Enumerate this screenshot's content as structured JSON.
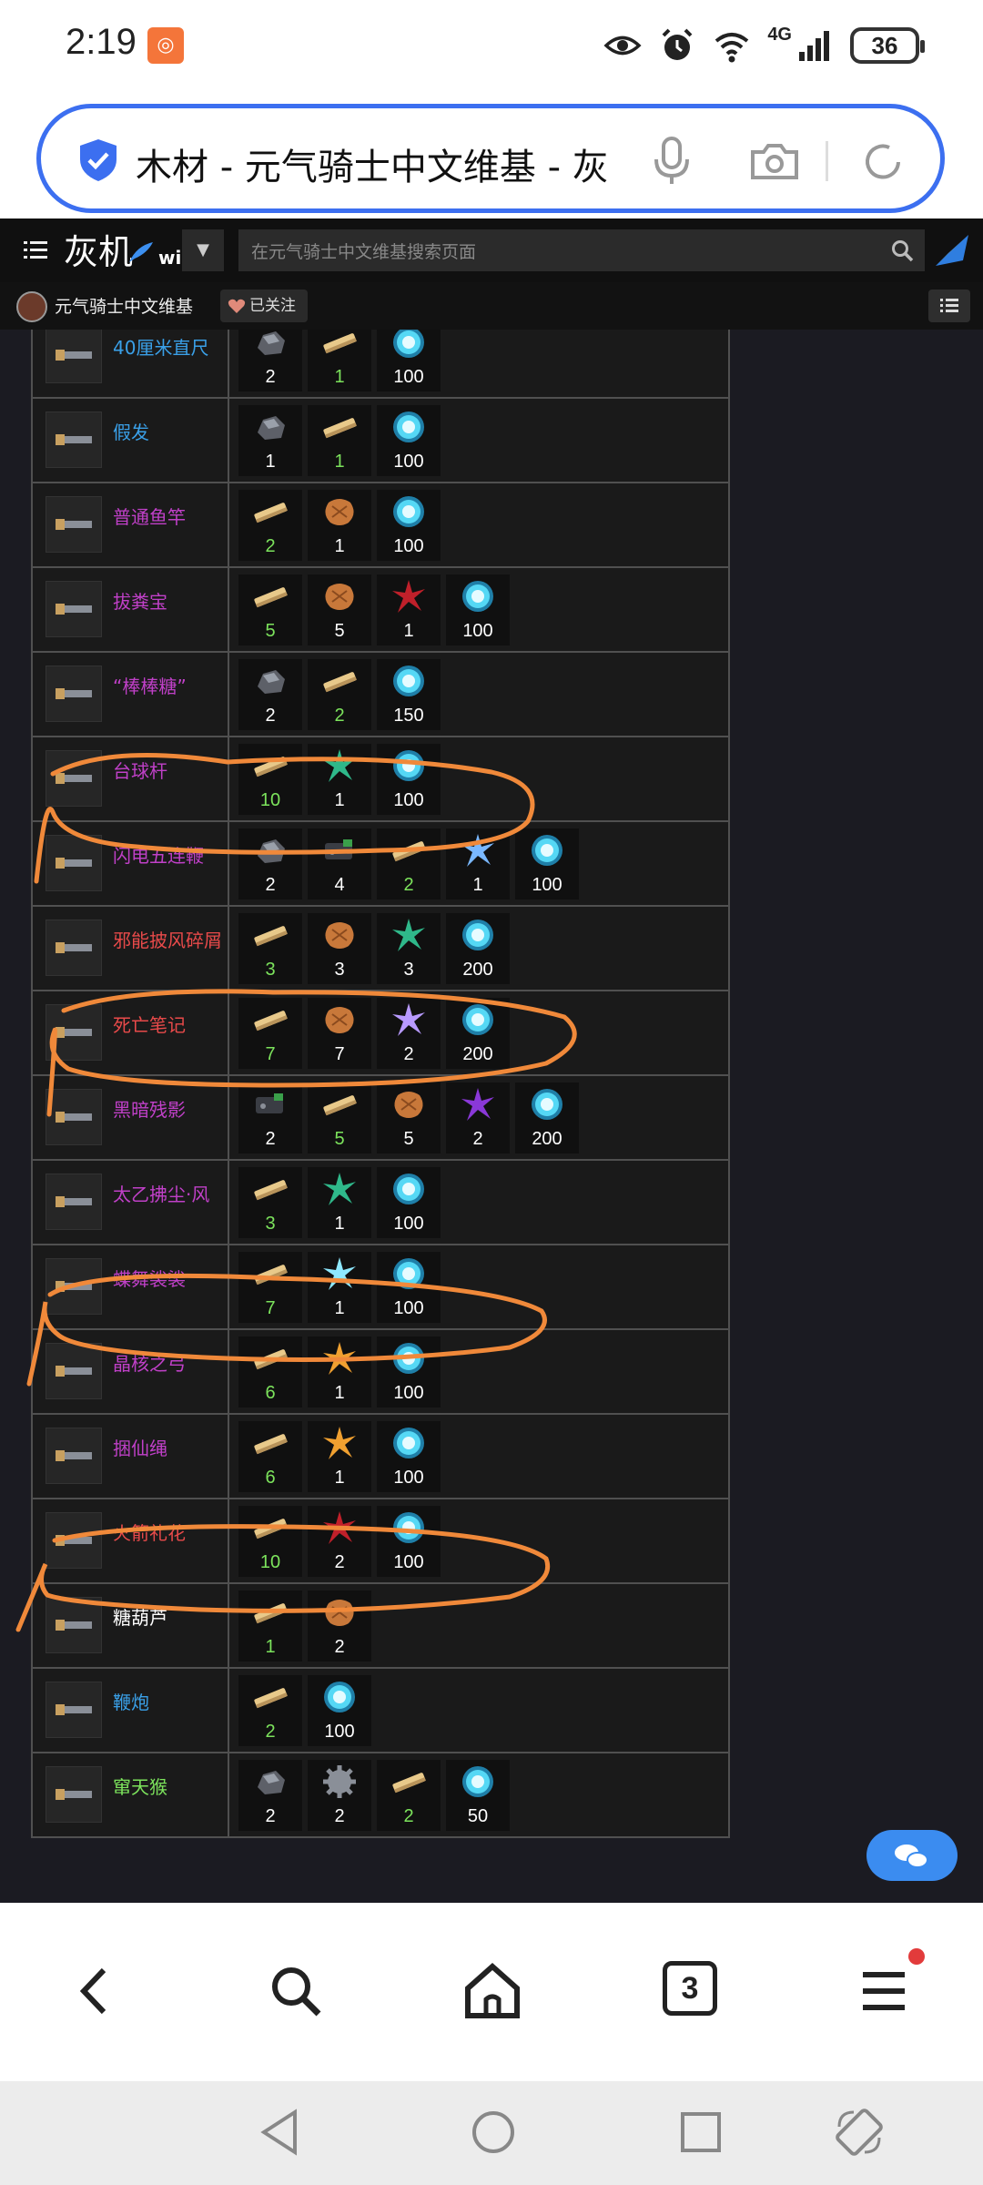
{
  "status_bar": {
    "time": "2:19",
    "network": "4G",
    "battery": "36",
    "app_icon": "weibo-style-app-icon"
  },
  "address_bar": {
    "title": "木材 - 元气骑士中文维基 - 灰"
  },
  "wiki_header": {
    "logo_text": "灰机",
    "logo_suffix": "wiki",
    "search_placeholder": "在元气骑士中文维基搜索页面",
    "site_name": "元气骑士中文维基",
    "follow_label": "已关注"
  },
  "materials_legend": {
    "ore": "#9aa0aa",
    "wood": "#e8c98a",
    "gem": "#55d8f5"
  },
  "crafting_rows": [
    {
      "name": "",
      "name_color": "#3aa0e8",
      "icon": "partial-row-icon",
      "materials": [
        {
          "type": "ore",
          "qty": "2"
        },
        {
          "type": "wood",
          "qty": "1"
        },
        {
          "type": "gem",
          "qty": "100"
        }
      ]
    },
    {
      "name": "40厘米直尺",
      "name_color": "#3aa0e8",
      "icon": "ruler-icon",
      "materials": [
        {
          "type": "ore",
          "qty": "2"
        },
        {
          "type": "wood",
          "qty": "1"
        },
        {
          "type": "gem",
          "qty": "100"
        }
      ]
    },
    {
      "name": "假发",
      "name_color": "#3aa0e8",
      "icon": "wig-icon",
      "materials": [
        {
          "type": "ore",
          "qty": "1"
        },
        {
          "type": "wood",
          "qty": "1"
        },
        {
          "type": "gem",
          "qty": "100"
        }
      ]
    },
    {
      "name": "普通鱼竿",
      "name_color": "#c040c8",
      "icon": "fishing-rod-icon",
      "materials": [
        {
          "type": "wood",
          "qty": "2"
        },
        {
          "type": "leather",
          "qty": "1"
        },
        {
          "type": "gem",
          "qty": "100"
        }
      ]
    },
    {
      "name": "拔粪宝",
      "name_color": "#c040c8",
      "icon": "plunger-icon",
      "materials": [
        {
          "type": "wood",
          "qty": "5"
        },
        {
          "type": "leather",
          "qty": "5"
        },
        {
          "type": "red-crystal",
          "qty": "1"
        },
        {
          "type": "gem",
          "qty": "100"
        }
      ]
    },
    {
      "name": "“棒棒糖”",
      "name_color": "#c040c8",
      "icon": "lollipop-icon",
      "materials": [
        {
          "type": "ore",
          "qty": "2"
        },
        {
          "type": "wood",
          "qty": "2"
        },
        {
          "type": "gem",
          "qty": "150"
        }
      ]
    },
    {
      "name": "台球杆",
      "name_color": "#c040c8",
      "icon": "cue-icon",
      "materials": [
        {
          "type": "wood",
          "qty": "10"
        },
        {
          "type": "green-crystal",
          "qty": "1"
        },
        {
          "type": "gem",
          "qty": "100"
        }
      ]
    },
    {
      "name": "闪电五连鞭",
      "name_color": "#c040c8",
      "icon": "whip-icon",
      "materials": [
        {
          "type": "ore",
          "qty": "2"
        },
        {
          "type": "circuit",
          "qty": "4"
        },
        {
          "type": "wood",
          "qty": "2"
        },
        {
          "type": "blue-crystal",
          "qty": "1"
        },
        {
          "type": "gem",
          "qty": "100"
        }
      ]
    },
    {
      "name": "邪能披风碎屑",
      "name_color": "#e84a4a",
      "icon": "cape-icon",
      "materials": [
        {
          "type": "wood",
          "qty": "3"
        },
        {
          "type": "leather",
          "qty": "3"
        },
        {
          "type": "green-crystal",
          "qty": "3"
        },
        {
          "type": "gem",
          "qty": "200"
        }
      ]
    },
    {
      "name": "死亡笔记",
      "name_color": "#e84a4a",
      "icon": "notebook-icon",
      "materials": [
        {
          "type": "wood",
          "qty": "7"
        },
        {
          "type": "leather",
          "qty": "7"
        },
        {
          "type": "purple-crystal",
          "qty": "2"
        },
        {
          "type": "gem",
          "qty": "200"
        }
      ]
    },
    {
      "name": "黑暗残影",
      "name_color": "#c040c8",
      "icon": "dark-orb-icon",
      "materials": [
        {
          "type": "circuit",
          "qty": "2"
        },
        {
          "type": "wood",
          "qty": "5"
        },
        {
          "type": "leather",
          "qty": "5"
        },
        {
          "type": "violet-crystal",
          "qty": "2"
        },
        {
          "type": "gem",
          "qty": "200"
        }
      ]
    },
    {
      "name": "太乙拂尘·风",
      "name_color": "#c040c8",
      "icon": "whisk-icon",
      "materials": [
        {
          "type": "wood",
          "qty": "3"
        },
        {
          "type": "green-crystal",
          "qty": "1"
        },
        {
          "type": "gem",
          "qty": "100"
        }
      ]
    },
    {
      "name": "蝶舞裟裟",
      "name_color": "#c040c8",
      "icon": "staff-icon",
      "materials": [
        {
          "type": "wood",
          "qty": "7"
        },
        {
          "type": "cyan-crystal",
          "qty": "1"
        },
        {
          "type": "gem",
          "qty": "100"
        }
      ]
    },
    {
      "name": "晶核之弓",
      "name_color": "#c040c8",
      "icon": "bow-icon",
      "materials": [
        {
          "type": "wood",
          "qty": "6"
        },
        {
          "type": "orange-crystal",
          "qty": "1"
        },
        {
          "type": "gem",
          "qty": "100"
        }
      ]
    },
    {
      "name": "捆仙绳",
      "name_color": "#c040c8",
      "icon": "rope-icon",
      "materials": [
        {
          "type": "wood",
          "qty": "6"
        },
        {
          "type": "orange-crystal",
          "qty": "1"
        },
        {
          "type": "gem",
          "qty": "100"
        }
      ]
    },
    {
      "name": "火箭礼花",
      "name_color": "#e84a4a",
      "icon": "rocket-icon",
      "materials": [
        {
          "type": "wood",
          "qty": "10"
        },
        {
          "type": "red-crystal",
          "qty": "2"
        },
        {
          "type": "gem",
          "qty": "100"
        }
      ]
    },
    {
      "name": "糖葫芦",
      "name_color": "#ffffff",
      "icon": "candied-haws-icon",
      "materials": [
        {
          "type": "wood",
          "qty": "1"
        },
        {
          "type": "leather",
          "qty": "2"
        }
      ]
    },
    {
      "name": "鞭炮",
      "name_color": "#3aa0e8",
      "icon": "firecracker-icon",
      "materials": [
        {
          "type": "wood",
          "qty": "2"
        },
        {
          "type": "gem",
          "qty": "100"
        }
      ]
    },
    {
      "name": "窜天猴",
      "name_color": "#7ce35c",
      "icon": "rocket-stick-icon",
      "materials": [
        {
          "type": "ore",
          "qty": "2"
        },
        {
          "type": "gear",
          "qty": "2"
        },
        {
          "type": "wood",
          "qty": "2"
        },
        {
          "type": "gem",
          "qty": "50"
        }
      ]
    }
  ]
}
